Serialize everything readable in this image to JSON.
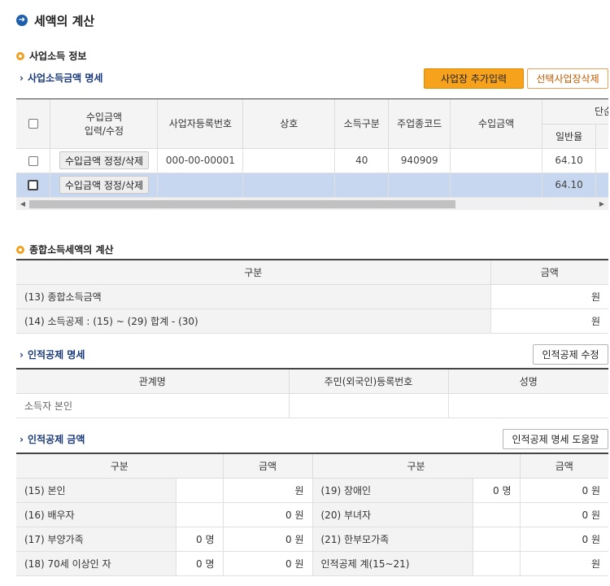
{
  "title": "세액의 계산",
  "business_info": {
    "heading": "사업소득 정보",
    "subheading": "사업소득금액 명세",
    "add_button": "사업장 추가입력",
    "delete_button": "선택사업장삭제",
    "columns": {
      "income_edit": [
        "수입금액",
        "입력/수정"
      ],
      "reg_no": "사업자등록번호",
      "trade_name": "상호",
      "income_type": "소득구분",
      "industry_code": "주업종코드",
      "income_amount": "수입금액",
      "simple_rate": "단순경비",
      "general_rate": "일반율"
    },
    "rows": [
      {
        "edit_button": "수입금액 정정/삭제",
        "reg_no": "000-00-00001",
        "trade_name": "",
        "income_type": "40",
        "industry_code": "940909",
        "income_amount": "",
        "general_rate": "64.10"
      },
      {
        "edit_button": "수입금액 정정/삭제",
        "reg_no": "",
        "trade_name": "",
        "income_type": "",
        "industry_code": "",
        "income_amount": "",
        "general_rate": "64.10"
      }
    ]
  },
  "tax_calc": {
    "heading": "종합소득세액의 계산",
    "col_category": "구분",
    "col_amount": "금액",
    "rows": [
      {
        "label": "(13) 종합소득금액",
        "unit": "원"
      },
      {
        "label": "(14) 소득공제 : (15) ~ (29) 합계 - (30)",
        "unit": "원"
      }
    ]
  },
  "personal_deduction": {
    "subheading": "인적공제 명세",
    "edit_button": "인적공제 수정",
    "col_relation": "관계명",
    "col_id": "주민(외국인)등록번호",
    "col_name": "성명",
    "rows": [
      {
        "relation": "소득자 본인",
        "id": "",
        "name": ""
      }
    ]
  },
  "deduction_amount": {
    "subheading": "인적공제 금액",
    "help_button": "인적공제 명세 도움말",
    "col_category": "구분",
    "col_amount": "금액",
    "rows": [
      {
        "l_label": "(15) 본인",
        "l_count": "",
        "l_amount": "원",
        "r_label": "(19) 장애인",
        "r_count": "0 명",
        "r_amount": "0 원"
      },
      {
        "l_label": "(16) 배우자",
        "l_count": "",
        "l_amount": "0 원",
        "r_label": "(20) 부녀자",
        "r_count": "",
        "r_amount": "0 원"
      },
      {
        "l_label": "(17) 부양가족",
        "l_count": "0 명",
        "l_amount": "0 원",
        "r_label": "(21) 한부모가족",
        "r_count": "",
        "r_amount": "0 원"
      },
      {
        "l_label": "(18) 70세 이상인 자",
        "l_count": "0 명",
        "l_amount": "0 원",
        "r_label": "인적공제 계(15~21)",
        "r_count": "",
        "r_amount": "원"
      }
    ]
  },
  "colors": {
    "title_icon": "#1f5faa",
    "orange_bullet": "#f0a020",
    "primary_button": "#f7a21d",
    "selected_row": "#c6d7ef",
    "subheading": "#1a3a7a"
  }
}
